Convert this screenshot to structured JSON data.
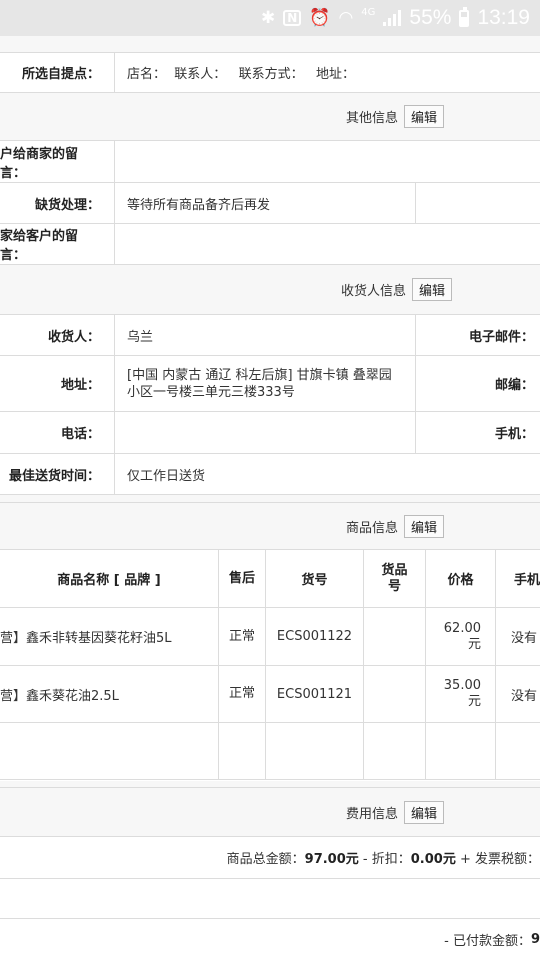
{
  "status_bar": {
    "battery_percent": "55%",
    "time": "13:19",
    "network": "4G",
    "icons": [
      "bluetooth-icon",
      "nfc-icon",
      "alarm-icon",
      "wifi-icon",
      "signal-icon",
      "battery-icon"
    ]
  },
  "pickup": {
    "label": "所选自提点：",
    "value": "店名：  联系人：   联系方式：   地址："
  },
  "other_info": {
    "title": "其他信息",
    "edit": "编辑",
    "rows": [
      {
        "label": "户给商家的留言：",
        "value": ""
      },
      {
        "label": "缺货处理：",
        "value": "等待所有商品备齐后再发"
      },
      {
        "label": "家给客户的留言：",
        "value": ""
      }
    ]
  },
  "consignee": {
    "title": "收货人信息",
    "edit": "编辑",
    "name_label": "收货人：",
    "name_value": "乌兰",
    "email_label": "电子邮件：",
    "address_label": "地址：",
    "address_value": "[中国 内蒙古 通辽 科左后旗] 甘旗卡镇 叠翠园小区一号楼三单元三楼333号",
    "zip_label": "邮编：",
    "phone_label": "电话：",
    "phone_value": "",
    "mobile_label": "手机：",
    "best_time_label": "最佳送货时间：",
    "best_time_value": "仅工作日送货"
  },
  "goods": {
    "title": "商品信息",
    "edit": "编辑",
    "headers": {
      "name": "商品名称 [ 品牌 ]",
      "after_sale": "售后",
      "sn": "货号",
      "goods_no": "货品号",
      "price": "价格",
      "phone": "手机"
    },
    "rows": [
      {
        "name": "营】鑫禾非转基因葵花籽油5L",
        "after_sale": "正常",
        "sn": "ECS001122",
        "goods_no": "",
        "price": "62.00元",
        "phone": "没有"
      },
      {
        "name": "营】鑫禾葵花油2.5L",
        "after_sale": "正常",
        "sn": "ECS001121",
        "goods_no": "",
        "price": "35.00元",
        "phone": "没有"
      }
    ]
  },
  "fees": {
    "title": "费用信息",
    "edit": "编辑",
    "goods_total_label": "商品总金额：",
    "goods_total": "97.00元",
    "discount_label": " - 折扣：",
    "discount": "0.00元",
    "tax_label": " + 发票税额：",
    "paid_label": "- 已付款金额：",
    "paid_value": "9"
  }
}
